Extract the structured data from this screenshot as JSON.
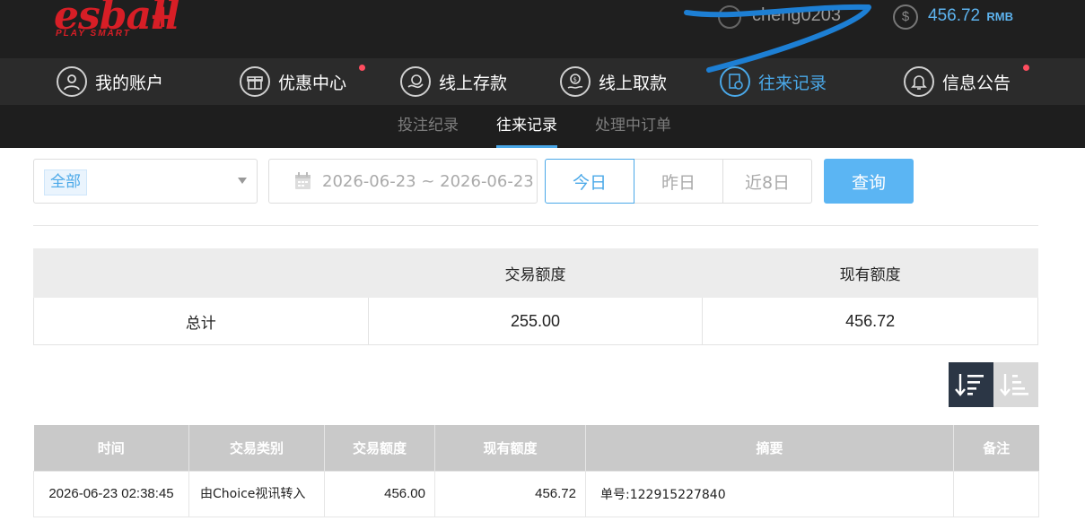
{
  "header": {
    "logo_text": "esball",
    "logo_plus": "+",
    "tagline": "PLAY SMART",
    "username": "cheng0203",
    "coin_symbol": "$",
    "balance": "456.72",
    "currency": "RMB"
  },
  "main_nav": {
    "items": [
      {
        "label": "我的账户",
        "icon": "user-icon",
        "dot": false
      },
      {
        "label": "优惠中心",
        "icon": "gift-icon",
        "dot": true
      },
      {
        "label": "线上存款",
        "icon": "deposit-icon",
        "dot": false
      },
      {
        "label": "线上取款",
        "icon": "withdraw-icon",
        "dot": false
      },
      {
        "label": "往来记录",
        "icon": "records-icon",
        "dot": false,
        "active": true
      },
      {
        "label": "信息公告",
        "icon": "bell-icon",
        "dot": true
      }
    ]
  },
  "sub_nav": {
    "items": [
      {
        "label": "投注纪录"
      },
      {
        "label": "往来记录",
        "active": true
      },
      {
        "label": "处理中订单"
      }
    ]
  },
  "filters": {
    "type_selected": "全部",
    "date_range": "2026-06-23 ~ 2026-06-23",
    "quick_ranges": [
      "今日",
      "昨日",
      "近8日"
    ],
    "active_range": "今日",
    "query_label": "查询"
  },
  "summary": {
    "headers": [
      "",
      "交易额度",
      "现有额度"
    ],
    "row_label": "总计",
    "transaction_amount": "255.00",
    "current_amount": "456.72"
  },
  "records": {
    "headers": [
      "时间",
      "交易类别",
      "交易额度",
      "现有额度",
      "摘要",
      "备注"
    ],
    "rows": [
      {
        "time": "2026-06-23 02:38:45",
        "category": "由Choice视讯转入",
        "amount": "456.00",
        "balance": "456.72",
        "memo": "单号:122915227840",
        "remark": ""
      }
    ]
  },
  "colors": {
    "accent": "#4aa8e8",
    "brand_red": "#d71e26",
    "notice_dot": "#ff4d5f",
    "header_bg": "#1f1f1f"
  }
}
